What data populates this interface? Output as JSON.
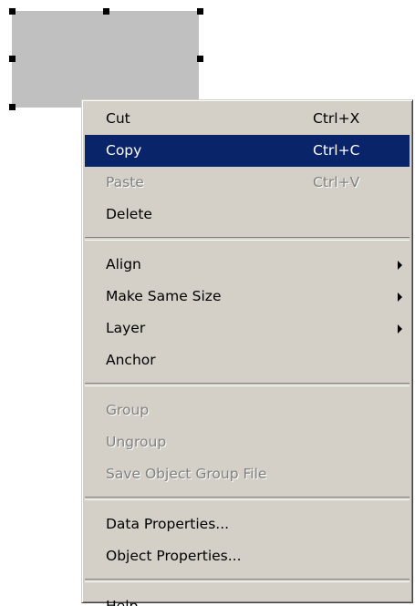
{
  "colors": {
    "menu_background": "#d4d0c8",
    "highlight": "#0a246a",
    "selected_object_fill": "#c0c0c0",
    "disabled_text": "#808080"
  },
  "context_menu": {
    "cut": {
      "label": "Cut",
      "shortcut": "Ctrl+X"
    },
    "copy": {
      "label": "Copy",
      "shortcut": "Ctrl+C"
    },
    "paste": {
      "label": "Paste",
      "shortcut": "Ctrl+V"
    },
    "delete": {
      "label": "Delete"
    },
    "align": {
      "label": "Align"
    },
    "make_same_size": {
      "label": "Make Same Size"
    },
    "layer": {
      "label": "Layer"
    },
    "anchor": {
      "label": "Anchor"
    },
    "group": {
      "label": "Group"
    },
    "ungroup": {
      "label": "Ungroup"
    },
    "save_object_group_file": {
      "label": "Save Object Group File"
    },
    "data_properties": {
      "label": "Data Properties..."
    },
    "object_properties": {
      "label": "Object Properties..."
    },
    "help": {
      "label": "Help"
    }
  }
}
